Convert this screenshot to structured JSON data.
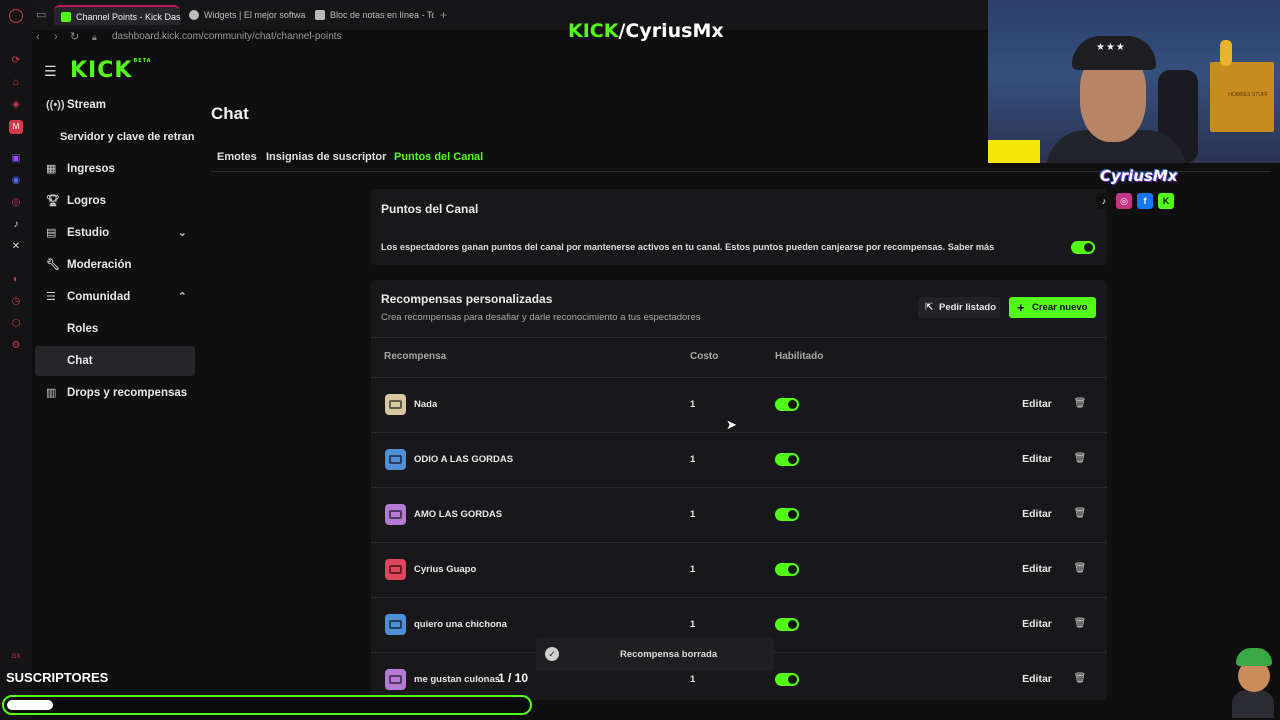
{
  "browser": {
    "tabs": [
      {
        "label": "Channel Points - Kick Das",
        "active": true,
        "favicon_color": "#53fc18"
      },
      {
        "label": "Widgets | El mejor softwa",
        "active": false,
        "favicon_color": "#bbbbbb"
      },
      {
        "label": "Bloc de notas en línea - To",
        "active": false,
        "favicon_color": "#bbbbbb"
      }
    ],
    "new_tab": "+",
    "url": "dashboard.kick.com/community/chat/channel-points"
  },
  "brand_overlay": {
    "kick": "KICK",
    "channel": "/CyriusMx"
  },
  "sidebar": {
    "logo": "KICK",
    "logo_badge": "BETA",
    "items": [
      {
        "label": "Stream",
        "icon": "broadcast-icon"
      },
      {
        "label": "Servidor y clave de retransm",
        "icon": ""
      },
      {
        "label": "Ingresos",
        "icon": "income-icon"
      },
      {
        "label": "Logros",
        "icon": "trophy-icon"
      },
      {
        "label": "Estudio",
        "icon": "studio-icon"
      },
      {
        "label": "Moderación",
        "icon": "wrench-icon"
      },
      {
        "label": "Comunidad",
        "icon": "community-icon"
      },
      {
        "label": "Roles",
        "icon": ""
      },
      {
        "label": "Chat",
        "icon": ""
      },
      {
        "label": "Drops y recompensas",
        "icon": "drops-icon"
      }
    ]
  },
  "page": {
    "title": "Chat",
    "tabs": [
      "Emotes",
      "Insignias de suscriptor",
      "Puntos del Canal"
    ],
    "active_tab": "Puntos del Canal"
  },
  "channel_points": {
    "title": "Puntos del Canal",
    "description": "Los espectadores ganan puntos del canal por mantenerse activos en tu canal. Estos puntos pueden canjearse por recompensas. Saber más",
    "enabled": true
  },
  "rewards": {
    "title": "Recompensas personalizadas",
    "subtitle": "Crea recompensas para desafiar y darle reconocimiento a tus espectadores",
    "list_button": "Pedir listado",
    "new_button": "Crear nuevo",
    "columns": [
      "Recompensa",
      "Costo",
      "Habilitado"
    ],
    "edit_label": "Editar",
    "items": [
      {
        "name": "Nada",
        "cost": "1",
        "enabled": true,
        "color": "#d8c8a2"
      },
      {
        "name": "ODIO A LAS GORDAS",
        "cost": "1",
        "enabled": true,
        "color": "#4f8fd6"
      },
      {
        "name": "AMO LAS GORDAS",
        "cost": "1",
        "enabled": true,
        "color": "#b57ad6"
      },
      {
        "name": "Cyrius Guapo",
        "cost": "1",
        "enabled": true,
        "color": "#e0475e"
      },
      {
        "name": "quiero una chichona",
        "cost": "1",
        "enabled": true,
        "color": "#4f8fd6"
      },
      {
        "name": "me gustan culonas",
        "cost": "1",
        "enabled": true,
        "color": "#b57ad6"
      }
    ]
  },
  "toast": {
    "message": "Recompensa borrada"
  },
  "overlay": {
    "tagline": "CyriusMx",
    "subs_label": "SUSCRIPTORES",
    "subs_progress": "1 / 10",
    "subs_fraction": 0.1,
    "shelf_text": "HOBBIES STUFF"
  },
  "colors": {
    "accent": "#53fc18",
    "background": "#0f0f10",
    "card": "#18181b"
  }
}
